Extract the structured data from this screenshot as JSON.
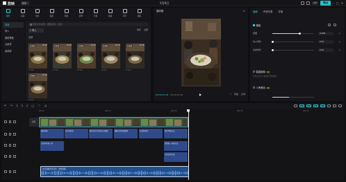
{
  "app": {
    "name": "剪映",
    "menu_label": "菜单",
    "doc_title": "5月9日",
    "vip_label": "VIP",
    "export_label": "导出"
  },
  "toolbar": [
    {
      "label": "媒体",
      "icon": "media-icon",
      "active": true
    },
    {
      "label": "音频",
      "icon": "audio-icon"
    },
    {
      "label": "文本",
      "icon": "text-icon"
    },
    {
      "label": "贴纸",
      "icon": "sticker-icon"
    },
    {
      "label": "特效",
      "icon": "effects-icon"
    },
    {
      "label": "转场",
      "icon": "transition-icon"
    },
    {
      "label": "字幕",
      "icon": "caption-icon"
    },
    {
      "label": "滤镜",
      "icon": "filter-icon"
    },
    {
      "label": "调节",
      "icon": "adjust-icon"
    },
    {
      "label": "模板",
      "icon": "template-icon"
    }
  ],
  "sidebar": [
    {
      "label": "本地",
      "active": true
    },
    {
      "label": "导入"
    },
    {
      "label": "我的预设"
    },
    {
      "label": "云素材"
    },
    {
      "label": "素材库"
    }
  ],
  "media": {
    "search_placeholder": "搜索文件名称、图层名称、标签",
    "import_label": "导入",
    "filters": [
      "排序",
      "全部"
    ],
    "all_label": "全部",
    "items": [
      {
        "tag": "已添加",
        "dur": "00:06",
        "name": "1.mp4"
      },
      {
        "tag": "已添加",
        "dur": "00:06",
        "name": "2.mp4"
      },
      {
        "tag": "已添加",
        "dur": "00:05",
        "name": "3.mp4"
      },
      {
        "tag": "已添加",
        "dur": "00:06",
        "name": "4.mp4"
      },
      {
        "tag": "已添加",
        "dur": "00:06",
        "name": "5.mp4"
      },
      {
        "tag": "已添加",
        "dur": "00:06",
        "name": "6.mp4"
      }
    ]
  },
  "player": {
    "title": "播放器",
    "current_time": "00:00:21:26",
    "total_time": "00:00:41:08",
    "right_controls": [
      "原始",
      "比例"
    ]
  },
  "properties": {
    "tabs": [
      {
        "label": "画面",
        "active": true
      },
      {
        "label": "声音效果"
      },
      {
        "label": "变速"
      }
    ],
    "sections": {
      "basic": "基础",
      "smart": "智能抠像",
      "smart_sub": "开启后可对人物进行智能抠像",
      "voice": "人声美化"
    },
    "rows": [
      {
        "label": "音量",
        "value": "0.0dB",
        "fill": 0.65
      },
      {
        "label": "淡入时长",
        "value": "0.0s",
        "fill": 0.0
      },
      {
        "label": "淡出时长",
        "value": "0.0s",
        "fill": 0.0
      }
    ]
  },
  "timeline": {
    "tools": [
      "↶",
      "↷",
      "⫿",
      "⫿",
      "⫿",
      "□",
      "♡",
      "◎"
    ],
    "cover_label": "封面",
    "ruler": [
      "00:00",
      "|00:10",
      "|00:20",
      "|00:30",
      "|00:40"
    ],
    "tts_row1": [
      "很多时候",
      "生活中我们",
      "我们在生活中的点点滴滴",
      "都能让我们感受到",
      "生活的美好",
      "我们不能忘记"
    ],
    "tts_row2": [
      "生活中的每一刻",
      "珍惜每一天的生活"
    ],
    "tts_row3": [
      "与你分享生活"
    ],
    "audio_label": "生活温暖背景音乐 - 轻松温馨"
  },
  "colors": {
    "accent": "#2fd0d5",
    "video_clip": "#2d5a5f",
    "tts_clip": "#2f4a8a",
    "audio_clip": "#1e4f8e"
  }
}
